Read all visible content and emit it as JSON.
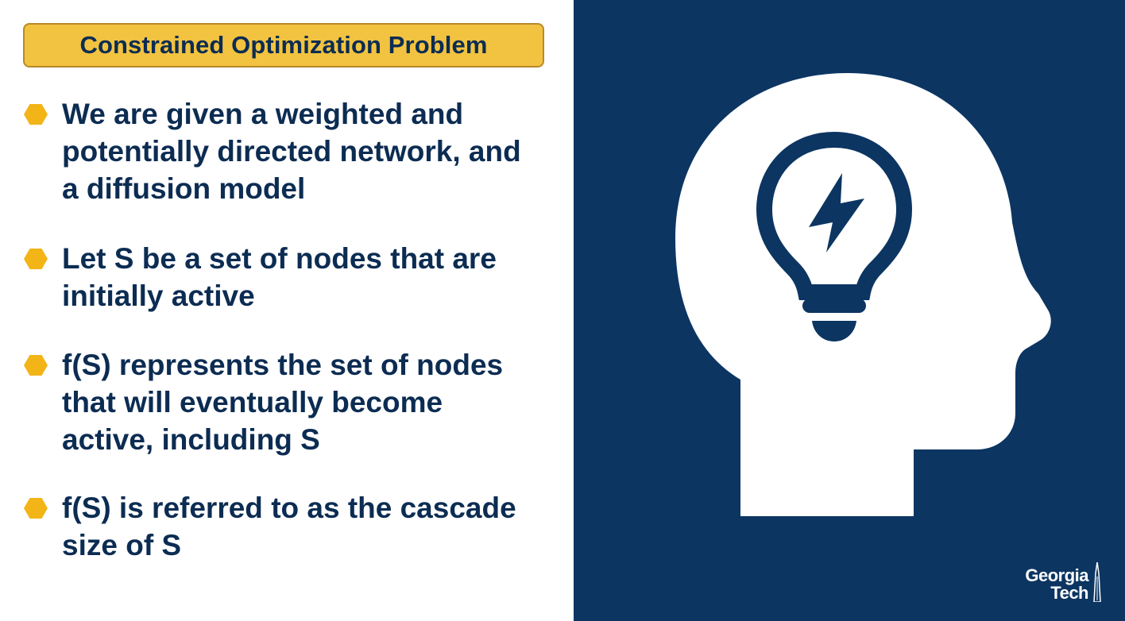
{
  "slide": {
    "title": "Constrained Optimization Problem",
    "bullets": [
      {
        "text": "We are given a weighted and\npotentially directed network, and\na diffusion model"
      },
      {
        "text": "Let S be a set of nodes that are\ninitially active"
      },
      {
        "text": "f(S) represents the set of nodes\nthat will eventually become\nactive, including S"
      },
      {
        "text": "f(S) is referred to as the cascade\nsize of S"
      }
    ]
  },
  "illustration": {
    "icon": "head-with-lightbulb-icon",
    "background_color": "#0c3562",
    "figure_color": "#ffffff"
  },
  "logo": {
    "line1": "Georgia",
    "line2": "Tech"
  },
  "colors": {
    "title_fill": "#f2c340",
    "title_border": "#b8892a",
    "text": "#0c2c52",
    "bullet": "#f2b417"
  }
}
